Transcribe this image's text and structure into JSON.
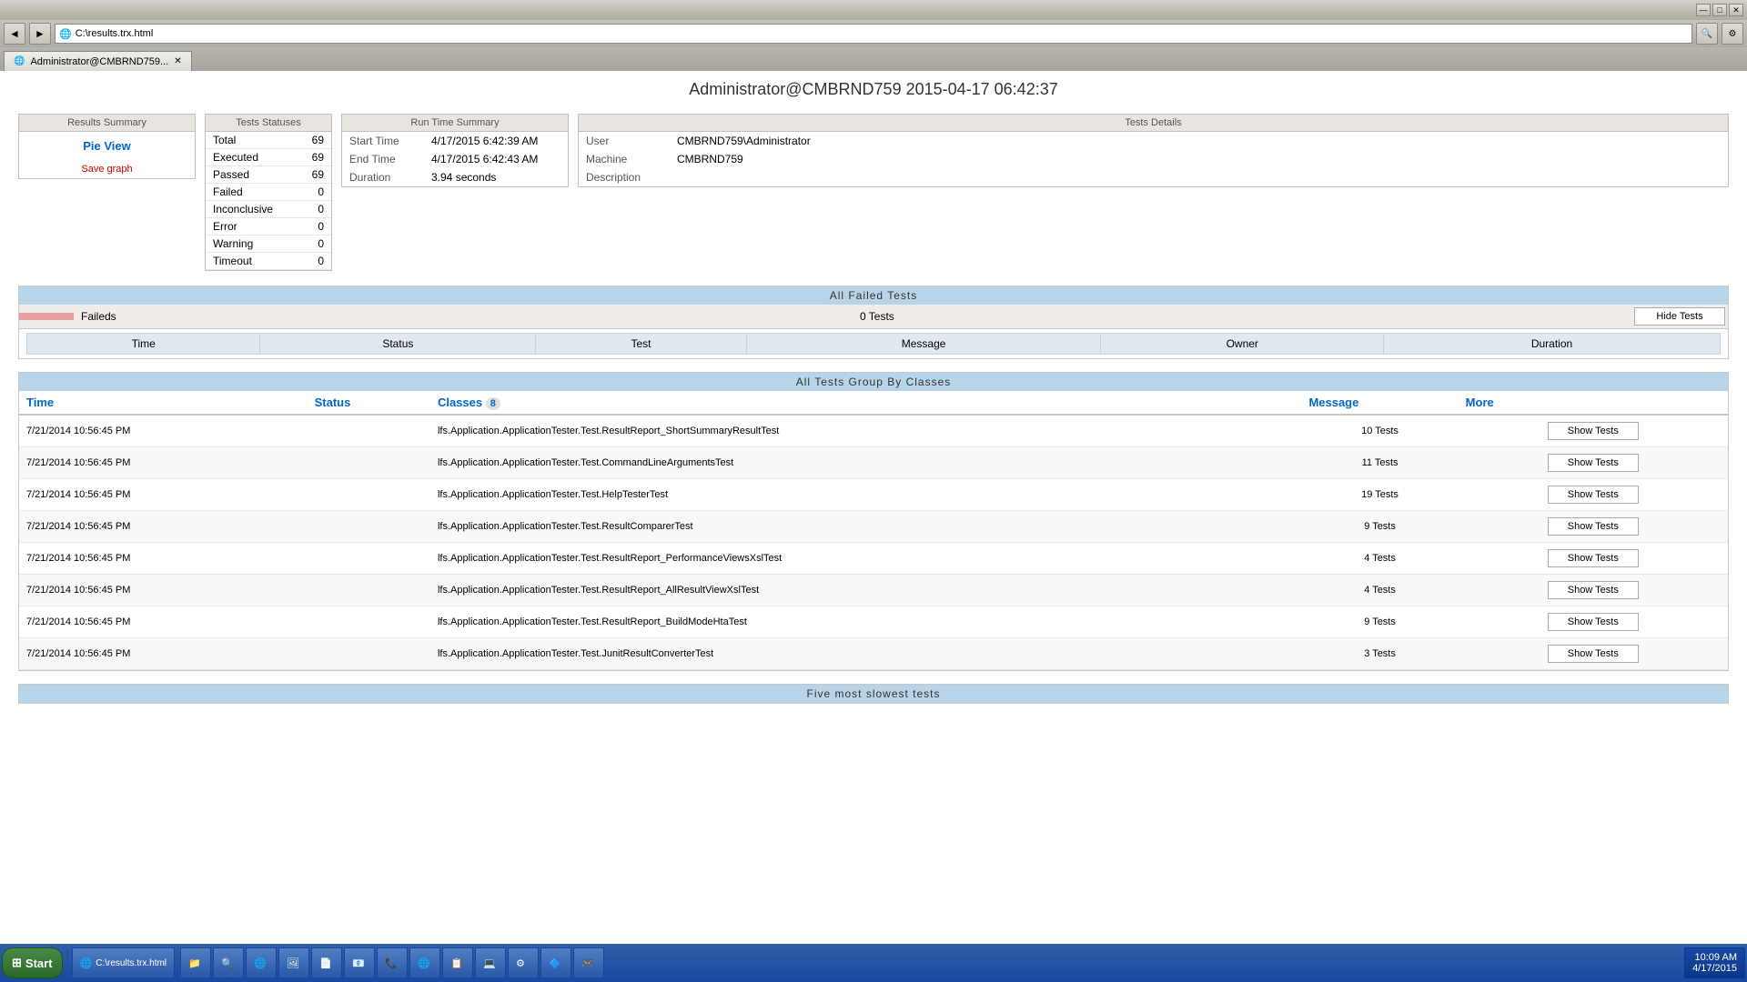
{
  "browser": {
    "title": "Administrator@CMBRND759...",
    "address": "C:\\results.trx.html",
    "tab_label": "Administrator@CMBRND759...",
    "nav_back": "◄",
    "nav_fwd": "►",
    "minimize": "—",
    "restore": "□",
    "close": "✕"
  },
  "page": {
    "title": "Administrator@CMBRND759 2015-04-17 06:42:37"
  },
  "results_summary": {
    "header": "Results Summary",
    "pie_view_label": "Pie View",
    "save_graph_label": "Save graph"
  },
  "test_statuses": {
    "header": "Tests Statuses",
    "rows": [
      {
        "label": "Total",
        "value": "69"
      },
      {
        "label": "Executed",
        "value": "69"
      },
      {
        "label": "Passed",
        "value": "69"
      },
      {
        "label": "Failed",
        "value": "0"
      },
      {
        "label": "Inconclusive",
        "value": "0"
      },
      {
        "label": "Error",
        "value": "0"
      },
      {
        "label": "Warning",
        "value": "0"
      },
      {
        "label": "Timeout",
        "value": "0"
      }
    ]
  },
  "run_time_summary": {
    "header": "Run Time Summary",
    "rows": [
      {
        "label": "Start Time",
        "value": "4/17/2015 6:42:39 AM"
      },
      {
        "label": "End Time",
        "value": "4/17/2015 6:42:43 AM"
      },
      {
        "label": "Duration",
        "value": "3.94 seconds"
      }
    ]
  },
  "tests_details": {
    "header": "Tests Details",
    "rows": [
      {
        "label": "User",
        "value": "CMBRND759\\Administrator"
      },
      {
        "label": "Machine",
        "value": "CMBRND759"
      },
      {
        "label": "Description",
        "value": ""
      }
    ]
  },
  "all_failed_tests": {
    "section_title": "All Failed Tests",
    "header_label": "",
    "header_name": "Faileds",
    "header_count": "0 Tests",
    "button_label": "Hide Tests",
    "columns": [
      "Time",
      "Status",
      "Test",
      "Message",
      "Owner",
      "Duration"
    ]
  },
  "all_tests_by_class": {
    "section_title": "All Tests Group By Classes",
    "col_time": "Time",
    "col_status": "Status",
    "col_classes": "Classes",
    "col_classes_count": "8",
    "col_message": "Message",
    "col_more": "More",
    "rows": [
      {
        "time": "7/21/2014 10:56:45 PM",
        "status": "",
        "class": "lfs.Application.ApplicationTester.Test.ResultReport_ShortSummaryResultTest",
        "message": "10 Tests",
        "button": "Show Tests"
      },
      {
        "time": "7/21/2014 10:56:45 PM",
        "status": "",
        "class": "lfs.Application.ApplicationTester.Test.CommandLineArgumentsTest",
        "message": "11 Tests",
        "button": "Show Tests"
      },
      {
        "time": "7/21/2014 10:56:45 PM",
        "status": "",
        "class": "lfs.Application.ApplicationTester.Test.HelpTesterTest",
        "message": "19 Tests",
        "button": "Show Tests"
      },
      {
        "time": "7/21/2014 10:56:45 PM",
        "status": "",
        "class": "lfs.Application.ApplicationTester.Test.ResultComparerTest",
        "message": "9 Tests",
        "button": "Show Tests"
      },
      {
        "time": "7/21/2014 10:56:45 PM",
        "status": "",
        "class": "lfs.Application.ApplicationTester.Test.ResultReport_PerformanceViewsXslTest",
        "message": "4 Tests",
        "button": "Show Tests"
      },
      {
        "time": "7/21/2014 10:56:45 PM",
        "status": "",
        "class": "lfs.Application.ApplicationTester.Test.ResultReport_AllResultViewXslTest",
        "message": "4 Tests",
        "button": "Show Tests"
      },
      {
        "time": "7/21/2014 10:56:45 PM",
        "status": "",
        "class": "lfs.Application.ApplicationTester.Test.ResultReport_BuildModeHtaTest",
        "message": "9 Tests",
        "button": "Show Tests"
      },
      {
        "time": "7/21/2014 10:56:45 PM",
        "status": "",
        "class": "lfs.Application.ApplicationTester.Test.JunitResultConverterTest",
        "message": "3 Tests",
        "button": "Show Tests"
      }
    ]
  },
  "five_slowest": {
    "section_title": "Five most slowest tests"
  },
  "taskbar": {
    "start_label": "Start",
    "clock_line1": "10:09 AM",
    "clock_line2": "4/17/2015",
    "items": [
      {
        "icon": "🌐",
        "label": "C:\\results.trx.html"
      }
    ]
  }
}
